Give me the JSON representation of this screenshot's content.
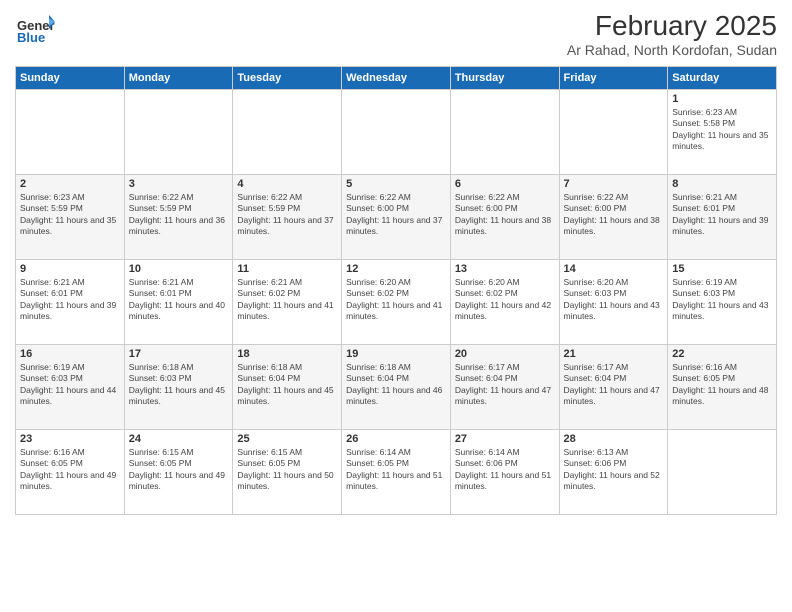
{
  "header": {
    "logo_general": "General",
    "logo_blue": "Blue",
    "title": "February 2025",
    "subtitle": "Ar Rahad, North Kordofan, Sudan"
  },
  "days_of_week": [
    "Sunday",
    "Monday",
    "Tuesday",
    "Wednesday",
    "Thursday",
    "Friday",
    "Saturday"
  ],
  "weeks": [
    {
      "days": [
        {
          "number": "",
          "info": ""
        },
        {
          "number": "",
          "info": ""
        },
        {
          "number": "",
          "info": ""
        },
        {
          "number": "",
          "info": ""
        },
        {
          "number": "",
          "info": ""
        },
        {
          "number": "",
          "info": ""
        },
        {
          "number": "1",
          "info": "Sunrise: 6:23 AM\nSunset: 5:58 PM\nDaylight: 11 hours and 35 minutes."
        }
      ]
    },
    {
      "days": [
        {
          "number": "2",
          "info": "Sunrise: 6:23 AM\nSunset: 5:59 PM\nDaylight: 11 hours and 35 minutes."
        },
        {
          "number": "3",
          "info": "Sunrise: 6:22 AM\nSunset: 5:59 PM\nDaylight: 11 hours and 36 minutes."
        },
        {
          "number": "4",
          "info": "Sunrise: 6:22 AM\nSunset: 5:59 PM\nDaylight: 11 hours and 37 minutes."
        },
        {
          "number": "5",
          "info": "Sunrise: 6:22 AM\nSunset: 6:00 PM\nDaylight: 11 hours and 37 minutes."
        },
        {
          "number": "6",
          "info": "Sunrise: 6:22 AM\nSunset: 6:00 PM\nDaylight: 11 hours and 38 minutes."
        },
        {
          "number": "7",
          "info": "Sunrise: 6:22 AM\nSunset: 6:00 PM\nDaylight: 11 hours and 38 minutes."
        },
        {
          "number": "8",
          "info": "Sunrise: 6:21 AM\nSunset: 6:01 PM\nDaylight: 11 hours and 39 minutes."
        }
      ]
    },
    {
      "days": [
        {
          "number": "9",
          "info": "Sunrise: 6:21 AM\nSunset: 6:01 PM\nDaylight: 11 hours and 39 minutes."
        },
        {
          "number": "10",
          "info": "Sunrise: 6:21 AM\nSunset: 6:01 PM\nDaylight: 11 hours and 40 minutes."
        },
        {
          "number": "11",
          "info": "Sunrise: 6:21 AM\nSunset: 6:02 PM\nDaylight: 11 hours and 41 minutes."
        },
        {
          "number": "12",
          "info": "Sunrise: 6:20 AM\nSunset: 6:02 PM\nDaylight: 11 hours and 41 minutes."
        },
        {
          "number": "13",
          "info": "Sunrise: 6:20 AM\nSunset: 6:02 PM\nDaylight: 11 hours and 42 minutes."
        },
        {
          "number": "14",
          "info": "Sunrise: 6:20 AM\nSunset: 6:03 PM\nDaylight: 11 hours and 43 minutes."
        },
        {
          "number": "15",
          "info": "Sunrise: 6:19 AM\nSunset: 6:03 PM\nDaylight: 11 hours and 43 minutes."
        }
      ]
    },
    {
      "days": [
        {
          "number": "16",
          "info": "Sunrise: 6:19 AM\nSunset: 6:03 PM\nDaylight: 11 hours and 44 minutes."
        },
        {
          "number": "17",
          "info": "Sunrise: 6:18 AM\nSunset: 6:03 PM\nDaylight: 11 hours and 45 minutes."
        },
        {
          "number": "18",
          "info": "Sunrise: 6:18 AM\nSunset: 6:04 PM\nDaylight: 11 hours and 45 minutes."
        },
        {
          "number": "19",
          "info": "Sunrise: 6:18 AM\nSunset: 6:04 PM\nDaylight: 11 hours and 46 minutes."
        },
        {
          "number": "20",
          "info": "Sunrise: 6:17 AM\nSunset: 6:04 PM\nDaylight: 11 hours and 47 minutes."
        },
        {
          "number": "21",
          "info": "Sunrise: 6:17 AM\nSunset: 6:04 PM\nDaylight: 11 hours and 47 minutes."
        },
        {
          "number": "22",
          "info": "Sunrise: 6:16 AM\nSunset: 6:05 PM\nDaylight: 11 hours and 48 minutes."
        }
      ]
    },
    {
      "days": [
        {
          "number": "23",
          "info": "Sunrise: 6:16 AM\nSunset: 6:05 PM\nDaylight: 11 hours and 49 minutes."
        },
        {
          "number": "24",
          "info": "Sunrise: 6:15 AM\nSunset: 6:05 PM\nDaylight: 11 hours and 49 minutes."
        },
        {
          "number": "25",
          "info": "Sunrise: 6:15 AM\nSunset: 6:05 PM\nDaylight: 11 hours and 50 minutes."
        },
        {
          "number": "26",
          "info": "Sunrise: 6:14 AM\nSunset: 6:05 PM\nDaylight: 11 hours and 51 minutes."
        },
        {
          "number": "27",
          "info": "Sunrise: 6:14 AM\nSunset: 6:06 PM\nDaylight: 11 hours and 51 minutes."
        },
        {
          "number": "28",
          "info": "Sunrise: 6:13 AM\nSunset: 6:06 PM\nDaylight: 11 hours and 52 minutes."
        },
        {
          "number": "",
          "info": ""
        }
      ]
    }
  ]
}
